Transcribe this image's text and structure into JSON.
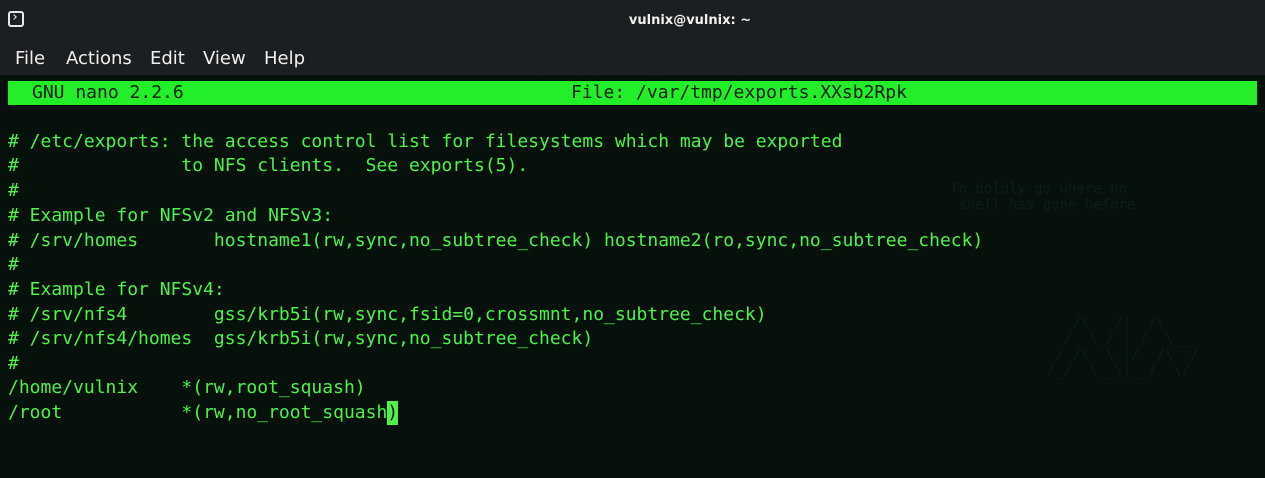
{
  "window": {
    "title": "vulnix@vulnix: ~"
  },
  "menu": [
    "File",
    "Actions",
    "Edit",
    "View",
    "Help"
  ],
  "nano": {
    "version": "GNU nano 2.2.6",
    "file": "File: /var/tmp/exports.XXsb2Rpk"
  },
  "lines": [
    "# /etc/exports: the access control list for filesystems which may be exported",
    "#               to NFS clients.  See exports(5).",
    "#",
    "# Example for NFSv2 and NFSv3:",
    "# /srv/homes       hostname1(rw,sync,no_subtree_check) hostname2(ro,sync,no_subtree_check)",
    "#",
    "# Example for NFSv4:",
    "# /srv/nfs4        gss/krb5i(rw,sync,fsid=0,crossmnt,no_subtree_check)",
    "# /srv/nfs4/homes  gss/krb5i(rw,sync,no_subtree_check)",
    "#",
    "/home/vulnix    *(rw,root_squash)",
    "/root           *(rw,no_root_squash"
  ],
  "cursor_char": ")",
  "colors": {
    "terminal_text": "#4ef24a",
    "nano_header_bg": "#22ee2a"
  },
  "icons": {
    "window": "terminal-icon"
  }
}
